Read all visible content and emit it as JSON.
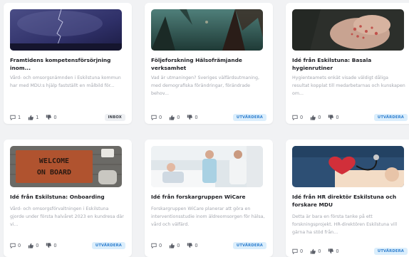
{
  "colors": {
    "accent": "#2f7fcf",
    "badge_eval_bg": "#dbeefc",
    "badge_sent_bg": "#eef0f3"
  },
  "cards": [
    {
      "title": "Framtidens kompetensförsörjning inom...",
      "excerpt": "Vård- och omsorgsnämnden i Eskilstuna kommun har med MDU:s hjälp fastställt en målbild för...",
      "comments": "1",
      "likes": "1",
      "dislikes": "0",
      "badge": "INBOX",
      "badge_type": "sent",
      "image": "storm-lightning-photo"
    },
    {
      "title": "Följeforskning Hälsofrämjande verksamhet",
      "excerpt": "Vad är utmaningen? Sveriges välfärdsutmaning, med demografiska förändringar, förändrade behov...",
      "comments": "0",
      "likes": "0",
      "dislikes": "0",
      "badge": "UTVÄRDERA",
      "badge_type": "eval",
      "image": "forest-trees-photo"
    },
    {
      "title": "Idé från Eskilstuna: Basala hygienrutiner",
      "excerpt": "Hygienteamets enkät visade väldigt dåliga resultat kopplat till medarbetarnas och kunskapen om...",
      "comments": "0",
      "likes": "0",
      "dislikes": "0",
      "badge": "UTVÄRDERA",
      "badge_type": "eval",
      "image": "hands-bacteria-photo"
    },
    {
      "title": "Idé från Eskilstuna: Onboarding",
      "excerpt": "Vård- och omsorgsförvaltningen i Eskilstuna gjorde under första halvåret 2023 en kundresa där vi...",
      "comments": "0",
      "likes": "0",
      "dislikes": "0",
      "badge": "UTVÄRDERA",
      "badge_type": "eval",
      "image": "welcome-on-board-doormat-photo",
      "image_text": [
        "WELCOME",
        "ON BOARD"
      ]
    },
    {
      "title": "Idé från forskargruppen WiCare",
      "excerpt": "Forskargruppen WiCare planerar att göra en interventionsstudie inom äldreomsorgen för hälsa, vård och välfärd.",
      "comments": "0",
      "likes": "0",
      "dislikes": "0",
      "badge": "UTVÄRDERA",
      "badge_type": "eval",
      "image": "care-staff-patient-photo"
    },
    {
      "title": "Idé från HR direktör Eskilstuna och forskare MDU",
      "excerpt": "Detta är bara en första tanke på ett forskningsprojekt. HR-direktören Eskilstuna vill gärna ha stöd från...",
      "comments": "0",
      "likes": "0",
      "dislikes": "0",
      "badge": "UTVÄRDERA",
      "badge_type": "eval",
      "image": "stethoscope-heart-photo"
    }
  ]
}
